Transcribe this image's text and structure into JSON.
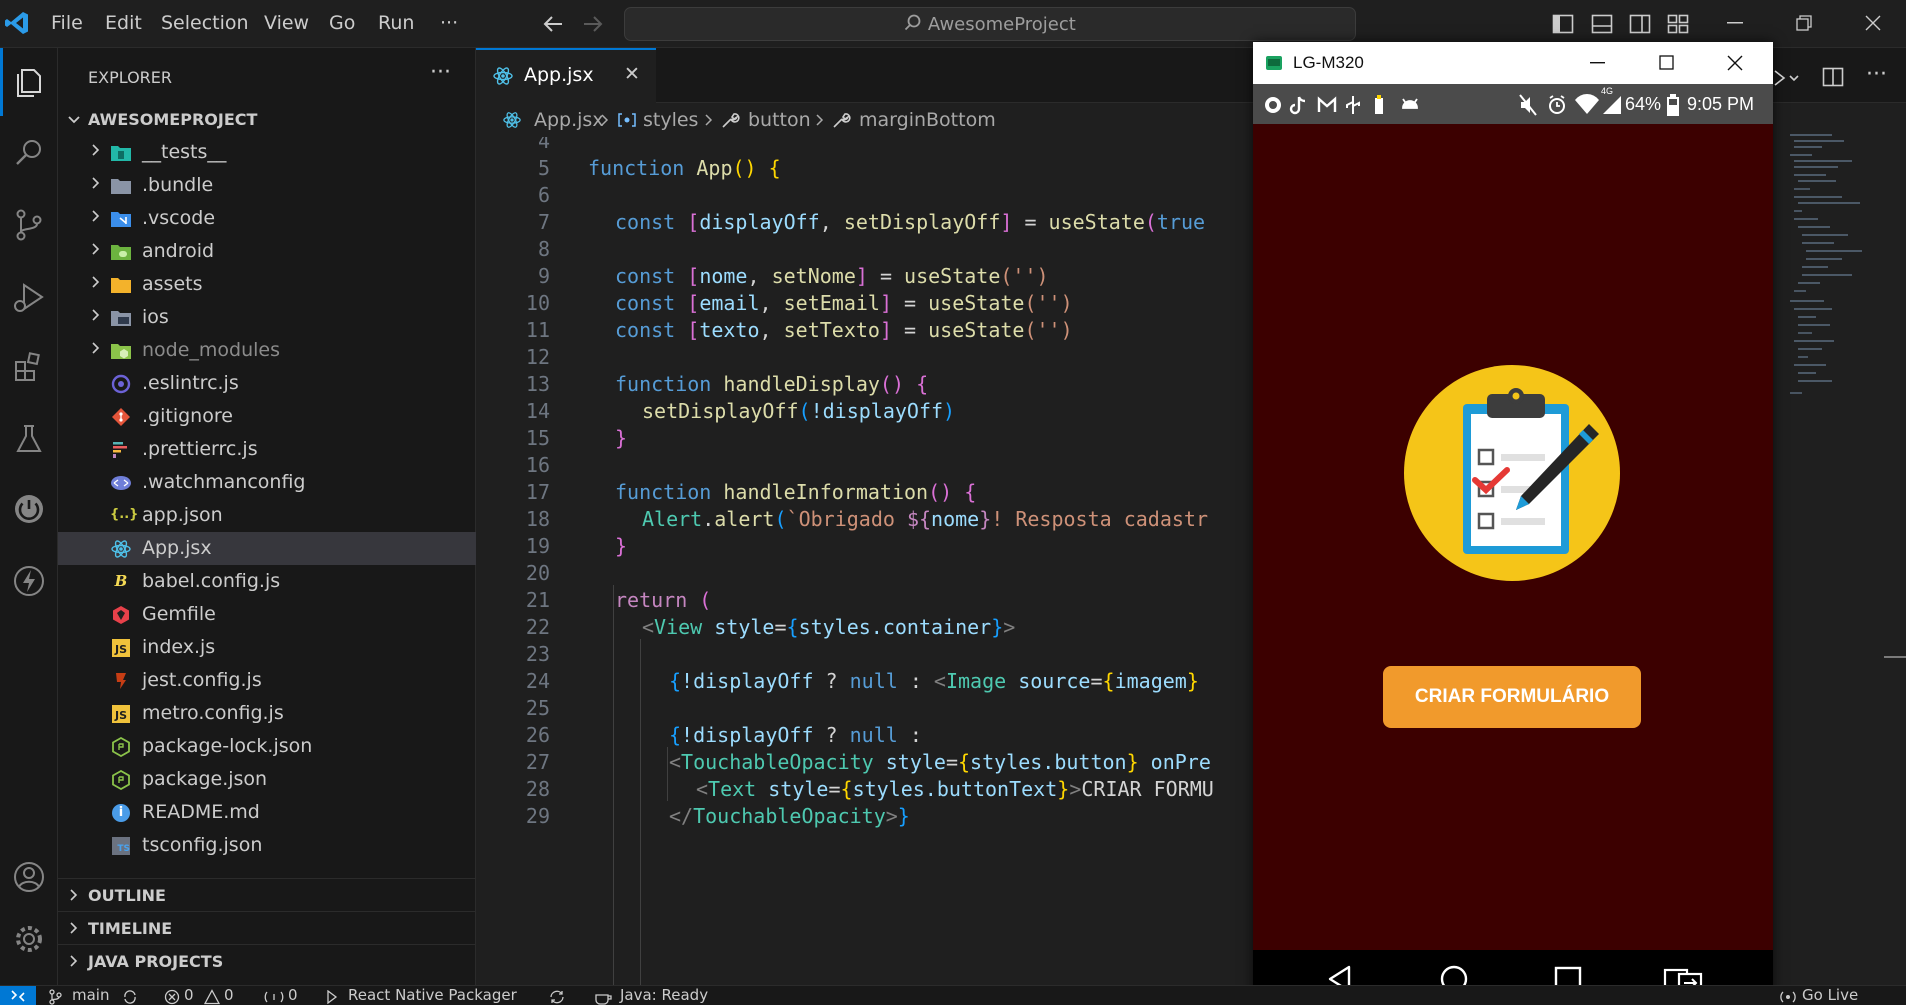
{
  "menu": {
    "file": "File",
    "edit": "Edit",
    "selection": "Selection",
    "view": "View",
    "go": "Go",
    "run": "Run",
    "more": "···"
  },
  "search": {
    "text": "AwesomeProject"
  },
  "explorer": {
    "title": "EXPLORER",
    "more": "···",
    "project": "AWESOMEPROJECT",
    "items": [
      {
        "label": "__tests__",
        "type": "folder"
      },
      {
        "label": ".bundle",
        "type": "folder"
      },
      {
        "label": ".vscode",
        "type": "folder"
      },
      {
        "label": "android",
        "type": "folder"
      },
      {
        "label": "assets",
        "type": "folder"
      },
      {
        "label": "ios",
        "type": "folder"
      },
      {
        "label": "node_modules",
        "type": "folder"
      },
      {
        "label": ".eslintrc.js",
        "type": "file"
      },
      {
        "label": ".gitignore",
        "type": "file"
      },
      {
        "label": ".prettierrc.js",
        "type": "file"
      },
      {
        "label": ".watchmanconfig",
        "type": "file"
      },
      {
        "label": "app.json",
        "type": "file"
      },
      {
        "label": "App.jsx",
        "type": "file"
      },
      {
        "label": "babel.config.js",
        "type": "file"
      },
      {
        "label": "Gemfile",
        "type": "file"
      },
      {
        "label": "index.js",
        "type": "file"
      },
      {
        "label": "jest.config.js",
        "type": "file"
      },
      {
        "label": "metro.config.js",
        "type": "file"
      },
      {
        "label": "package-lock.json",
        "type": "file"
      },
      {
        "label": "package.json",
        "type": "file"
      },
      {
        "label": "README.md",
        "type": "file"
      },
      {
        "label": "tsconfig.json",
        "type": "file"
      }
    ],
    "icon_glyphs": {
      "app_json": "{..}",
      "index_js": "JS",
      "jest_js": "JS",
      "metro_js": "JS",
      "babel": "B",
      "readme": "i",
      "ts": "TS"
    },
    "panels": {
      "outline": "OUTLINE",
      "timeline": "TIMELINE",
      "java": "JAVA PROJECTS"
    }
  },
  "tab": {
    "label": "App.jsx",
    "close": "✕"
  },
  "breadcrumb": {
    "file": "App.jsx",
    "styles": "styles",
    "button": "button",
    "prop": "marginBottom"
  },
  "code": {
    "line_numbers": [
      "4",
      "5",
      "6",
      "7",
      "8",
      "9",
      "10",
      "11",
      "12",
      "13",
      "14",
      "15",
      "16",
      "17",
      "18",
      "19",
      "20",
      "21",
      "22",
      "23",
      "24",
      "25",
      "26",
      "27",
      "28",
      "29"
    ],
    "l5": {
      "kw": "function",
      "fn": "App",
      "paren": "()",
      "brace": "{"
    },
    "l7": {
      "kw": "const",
      "open": "[",
      "a": "displayOff",
      "comma": ", ",
      "b": "setDisplayOff",
      "close": "]",
      "eq": " = ",
      "fn": "useState",
      "paren": "(",
      "val": "true"
    },
    "l9": {
      "kw": "const",
      "open": "[",
      "a": "nome",
      "comma": ", ",
      "b": "setNome",
      "close": "]",
      "eq": " = ",
      "fn": "useState",
      "arg": "('')"
    },
    "l10": {
      "kw": "const",
      "open": "[",
      "a": "email",
      "comma": ", ",
      "b": "setEmail",
      "close": "]",
      "eq": " = ",
      "fn": "useState",
      "arg": "('')"
    },
    "l11": {
      "kw": "const",
      "open": "[",
      "a": "texto",
      "comma": ", ",
      "b": "setTexto",
      "close": "]",
      "eq": " = ",
      "fn": "useState",
      "arg": "('')"
    },
    "l13": {
      "kw": "function",
      "fn": "handleDisplay",
      "paren": "()",
      "brace": "{"
    },
    "l14": {
      "fn": "setDisplayOff",
      "open": "(",
      "arg": "!displayOff",
      "close": ")"
    },
    "l15": {
      "brace": "}"
    },
    "l17": {
      "kw": "function",
      "fn": "handleInformation",
      "paren": "()",
      "brace": "{"
    },
    "l18": {
      "obj": "Alert",
      "dot": ".",
      "fn": "alert",
      "open": "(",
      "s1": "`Obrigado ",
      "d1": "${",
      "v": "nome",
      "d2": "}",
      "s2": "! Resposta cadastr"
    },
    "l19": {
      "brace": "}"
    },
    "l21": {
      "kw": "return",
      "paren": " ("
    },
    "l22": {
      "lt": "<",
      "tag": "View",
      "attr": " style",
      "eq": "=",
      "b1": "{",
      "val": "styles.container",
      "b2": "}",
      "gt": ">"
    },
    "l24": {
      "b1": "{",
      "v": "!displayOff",
      "q": " ? ",
      "n": "null",
      "c": " : ",
      "lt": "<",
      "tag": "Image",
      "attr": " source",
      "eq": "=",
      "b2": "{",
      "img": "imagem",
      "b3": "}"
    },
    "l26": {
      "b1": "{",
      "v": "!displayOff",
      "q": " ? ",
      "n": "null",
      "c": " :"
    },
    "l27": {
      "lt": "<",
      "tag": "TouchableOpacity",
      "attr": " style",
      "eq": "=",
      "b1": "{",
      "val": "styles.button",
      "b2": "}",
      "attr2": " onPre"
    },
    "l28": {
      "lt": "<",
      "tag": "Text",
      "attr": " style",
      "eq": "=",
      "b1": "{",
      "val": "styles.buttonText",
      "b2": "}",
      "gt": ">",
      "txt": "CRIAR FORMU"
    },
    "l29": {
      "lt": "</",
      "tag": "TouchableOpacity",
      "gt": ">",
      "b": "}"
    }
  },
  "phone": {
    "title": "LG-M320",
    "battery": "64%",
    "time": "9:05 PM",
    "network": "4G",
    "button_label": "CRIAR FORMULÁRIO"
  },
  "statusbar": {
    "branch": "main",
    "errors": "0",
    "warnings": "0",
    "ports": "0",
    "packager": "React Native Packager",
    "java": "Java: Ready",
    "golive": "Go Live"
  },
  "colors": {
    "accent": "#0078d4",
    "phone_bg": "#3c0000",
    "button": "#f19a2c",
    "clipboard_circle": "#f5c518"
  }
}
